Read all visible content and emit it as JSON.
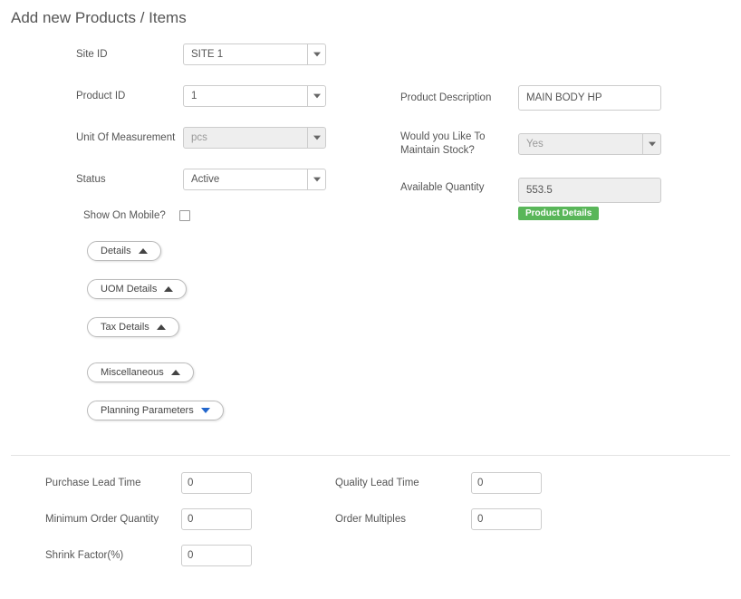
{
  "title": "Add new Products / Items",
  "left": {
    "siteId": {
      "label": "Site ID",
      "value": "SITE 1"
    },
    "productId": {
      "label": "Product ID",
      "value": "1"
    },
    "uom": {
      "label": "Unit Of Measurement",
      "value": "pcs"
    },
    "status": {
      "label": "Status",
      "value": "Active"
    },
    "showOnMobile": {
      "label": "Show On Mobile?",
      "checked": false
    }
  },
  "right": {
    "desc": {
      "label": "Product Description",
      "value": "MAIN BODY HP"
    },
    "maintainStock": {
      "label": "Would you Like To Maintain Stock?",
      "value": "Yes"
    },
    "availQty": {
      "label": "Available Quantity",
      "value": "553.5"
    },
    "badge": "Product Details"
  },
  "sections": {
    "details": "Details",
    "uomDetails": "UOM Details",
    "taxDetails": "Tax Details",
    "misc": "Miscellaneous",
    "planning": "Planning Parameters"
  },
  "planning": {
    "purchaseLead": {
      "label": "Purchase Lead Time",
      "value": "0"
    },
    "qualityLead": {
      "label": "Quality Lead Time",
      "value": "0"
    },
    "minOrderQty": {
      "label": "Minimum Order Quantity",
      "value": "0"
    },
    "orderMultiples": {
      "label": "Order Multiples",
      "value": "0"
    },
    "shrink": {
      "label": "Shrink Factor(%)",
      "value": "0"
    }
  }
}
